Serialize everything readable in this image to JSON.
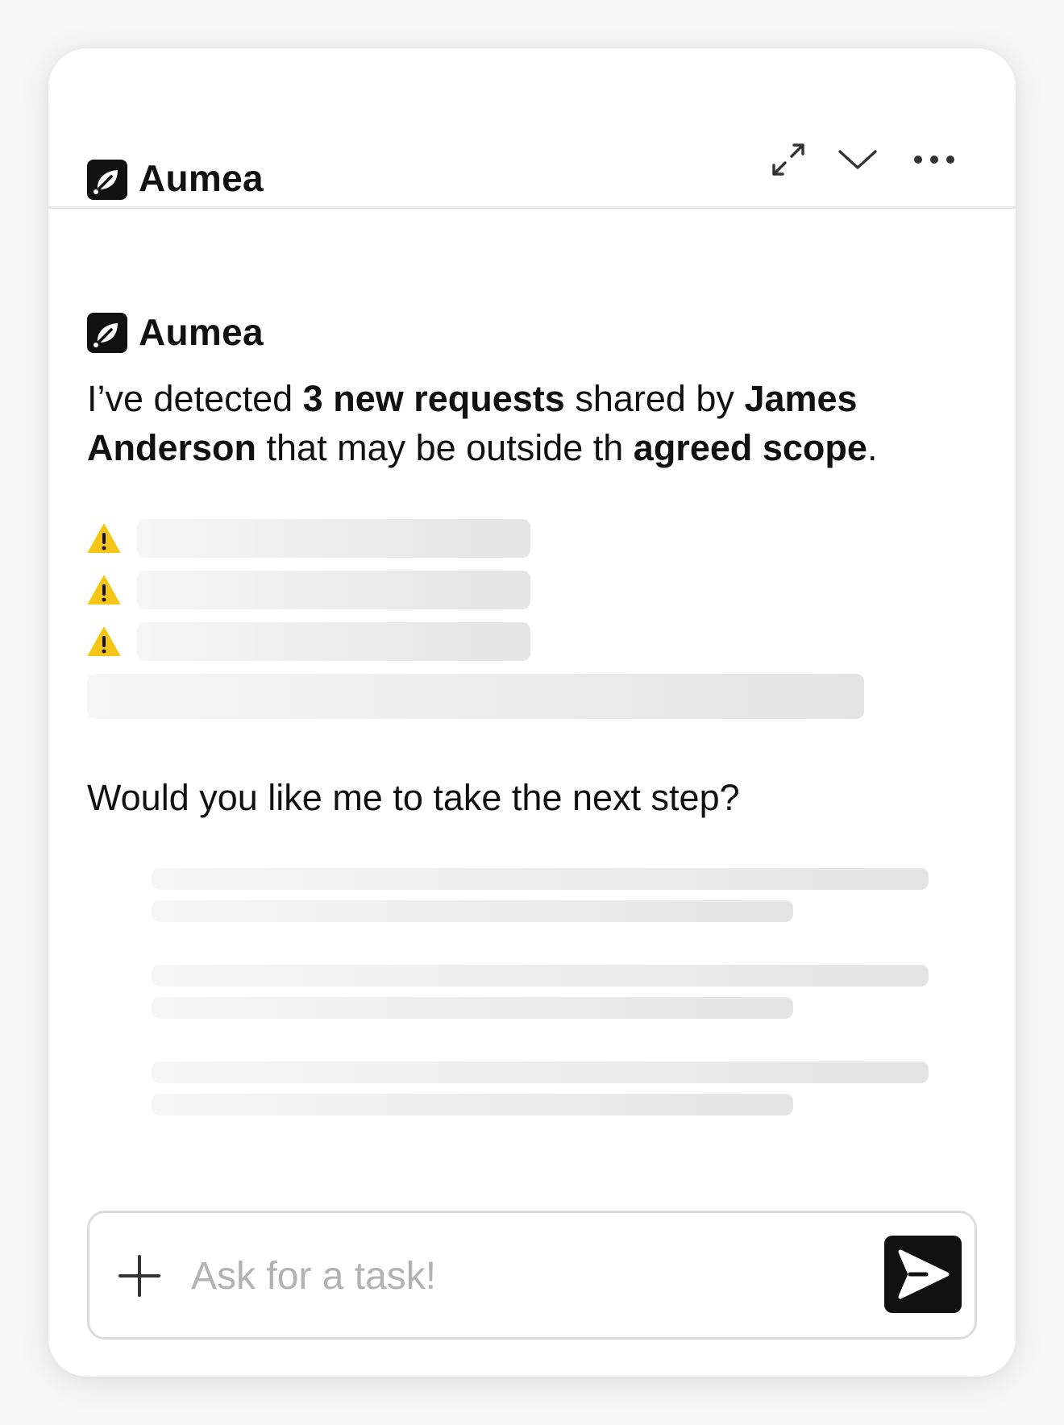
{
  "header": {
    "app_name": "Aumea",
    "icons": [
      "logo-icon",
      "expand-icon",
      "chevron-down-icon",
      "more-icon"
    ]
  },
  "message": {
    "sender": "Aumea",
    "intro": {
      "p1": "I’ve detected ",
      "b1": "3 new requests",
      "p2": " shared by ",
      "b2": "James Anderson",
      "p3": " that may be outside th ",
      "b3": "agreed scope",
      "p4": "."
    },
    "warning_icon": "warning-icon",
    "question": "Would you like me to take the next step?"
  },
  "composer": {
    "placeholder": "Ask for a task!",
    "value": "",
    "icons": [
      "plus-icon",
      "send-icon"
    ]
  },
  "colors": {
    "accent": "#111111",
    "warning": "#F5C518",
    "skeleton_start": "#f6f6f6",
    "skeleton_end": "#e4e4e4"
  }
}
